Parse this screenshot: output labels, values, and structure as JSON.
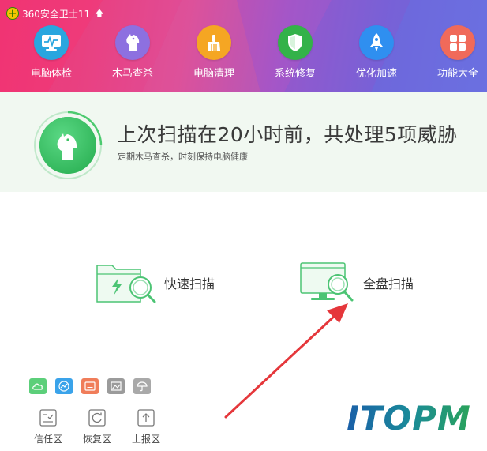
{
  "app": {
    "title": "360安全卫士11",
    "logo_glyph": "+",
    "update_glyph": "🡅"
  },
  "tabs": [
    {
      "label": "电脑体检",
      "icon": "monitor-pulse-icon",
      "color": "#2aa8e0"
    },
    {
      "label": "木马查杀",
      "icon": "horse-icon",
      "color": "#8c6fe0"
    },
    {
      "label": "电脑清理",
      "icon": "broom-icon",
      "color": "#f5a623"
    },
    {
      "label": "系统修复",
      "icon": "shield-check-icon",
      "color": "#34b34a"
    },
    {
      "label": "优化加速",
      "icon": "rocket-icon",
      "color": "#2f8ff0"
    },
    {
      "label": "功能大全",
      "icon": "grid-icon",
      "color": "#f06a5a"
    }
  ],
  "status": {
    "title": "上次扫描在20小时前，共处理5项威胁",
    "subtitle": "定期木马查杀，时刻保持电脑健康",
    "accent_color": "#3cc264"
  },
  "scan": {
    "quick_label": "快速扫描",
    "full_label": "全盘扫描"
  },
  "tool_icons": [
    {
      "icon": "cloud-icon",
      "color": "#5ccf7a"
    },
    {
      "icon": "chart-icon",
      "color": "#3aa3ea"
    },
    {
      "icon": "document-icon",
      "color": "#f07d5a"
    },
    {
      "icon": "image-icon",
      "color": "#9b9b9b"
    },
    {
      "icon": "umbrella-icon",
      "color": "#a9a9a9"
    }
  ],
  "zones": [
    {
      "label": "信任区",
      "icon": "trust-icon"
    },
    {
      "label": "恢复区",
      "icon": "restore-icon"
    },
    {
      "label": "上报区",
      "icon": "upload-icon"
    }
  ],
  "annotation": {
    "watermark": "ITOPM",
    "arrow_color": "#e5373b"
  }
}
